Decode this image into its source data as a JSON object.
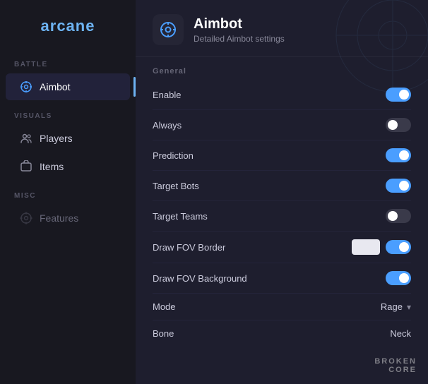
{
  "app": {
    "name": "arcane"
  },
  "sidebar": {
    "battle_label": "BATTLE",
    "visuals_label": "VISUALS",
    "misc_label": "MISC",
    "items": [
      {
        "id": "aimbot",
        "label": "Aimbot",
        "active": true,
        "dimmed": false,
        "icon": "aimbot-icon"
      },
      {
        "id": "players",
        "label": "Players",
        "active": false,
        "dimmed": false,
        "icon": "players-icon"
      },
      {
        "id": "items",
        "label": "Items",
        "active": false,
        "dimmed": false,
        "icon": "items-icon"
      },
      {
        "id": "features",
        "label": "Features",
        "active": false,
        "dimmed": true,
        "icon": "features-icon"
      }
    ]
  },
  "header": {
    "title": "Aimbot",
    "subtitle": "Detailed Aimbot settings",
    "icon": "aimbot-header-icon"
  },
  "general": {
    "section_label": "General",
    "settings": [
      {
        "id": "enable",
        "label": "Enable",
        "type": "toggle",
        "state": "on"
      },
      {
        "id": "always",
        "label": "Always",
        "type": "toggle",
        "state": "off"
      },
      {
        "id": "prediction",
        "label": "Prediction",
        "type": "toggle",
        "state": "on"
      },
      {
        "id": "target_bots",
        "label": "Target Bots",
        "type": "toggle",
        "state": "on"
      },
      {
        "id": "target_teams",
        "label": "Target Teams",
        "type": "toggle",
        "state": "off"
      },
      {
        "id": "draw_fov_border",
        "label": "Draw FOV Border",
        "type": "toggle_with_input",
        "state": "on"
      },
      {
        "id": "draw_fov_background",
        "label": "Draw FOV Background",
        "type": "toggle",
        "state": "on"
      },
      {
        "id": "mode",
        "label": "Mode",
        "type": "dropdown",
        "value": "Rage"
      },
      {
        "id": "bone",
        "label": "Bone",
        "type": "dropdown",
        "value": "Neck"
      }
    ]
  },
  "watermark": {
    "line1": "BROKEN",
    "line2": "CORE"
  }
}
